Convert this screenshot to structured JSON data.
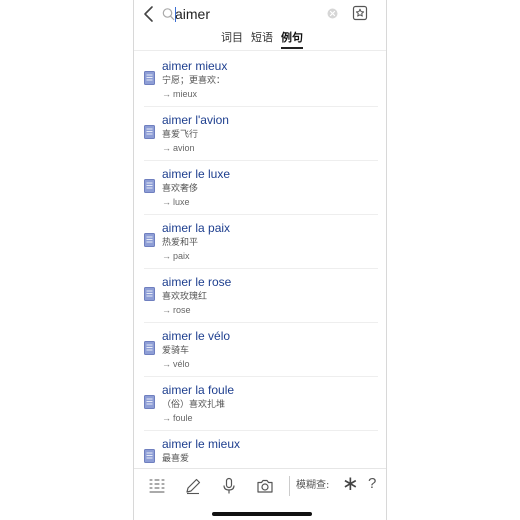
{
  "search": {
    "query": "aimer"
  },
  "tabs": [
    {
      "label": "词目",
      "active": false
    },
    {
      "label": "短语",
      "active": false
    },
    {
      "label": "例句",
      "active": true
    }
  ],
  "results": [
    {
      "headword": "aimer mieux",
      "meaning": "宁愿；更喜欢：",
      "link": "mieux"
    },
    {
      "headword": "aimer l'avion",
      "meaning": "喜爱飞行",
      "link": "avion"
    },
    {
      "headword": "aimer le luxe",
      "meaning": "喜欢奢侈",
      "link": "luxe"
    },
    {
      "headword": "aimer la paix",
      "meaning": "热爱和平",
      "link": "paix"
    },
    {
      "headword": "aimer le rose",
      "meaning": "喜欢玫瑰红",
      "link": "rose"
    },
    {
      "headword": "aimer le vélo",
      "meaning": "爱骑车",
      "link": "vélo"
    },
    {
      "headword": "aimer la foule",
      "meaning": "（俗）喜欢扎堆",
      "link": "foule"
    },
    {
      "headword": "aimer le mieux",
      "meaning": "最喜爱",
      "link": ""
    }
  ],
  "toolbar": {
    "fuzzy_label": "模糊查:",
    "wildcard": "∗",
    "question": "?",
    "icons": [
      "handwriting-grid-icon",
      "pen-icon",
      "microphone-icon",
      "camera-icon"
    ]
  },
  "colors": {
    "accent": "#1e3f8f",
    "book": "#7f8fcf"
  }
}
